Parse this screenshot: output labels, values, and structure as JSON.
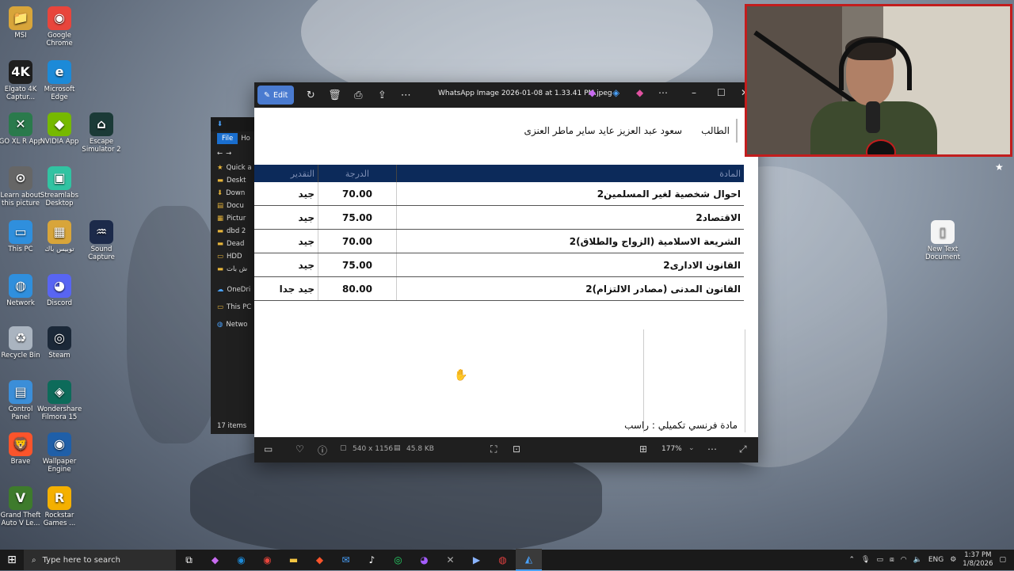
{
  "desktop_icons": [
    {
      "label": "MSI",
      "color": "#d8a53a",
      "glyph": "📁"
    },
    {
      "label": "Google Chrome",
      "color": "#e8453c",
      "glyph": "◉"
    },
    {
      "label": "Elgato 4K Captur...",
      "color": "#1f1f1f",
      "glyph": "4K"
    },
    {
      "label": "Microsoft Edge",
      "color": "#1c8ad8",
      "glyph": "e"
    },
    {
      "label": "GO XL R App",
      "color": "#2a7a4c",
      "glyph": "✕"
    },
    {
      "label": "NVIDIA App",
      "color": "#76b900",
      "glyph": "◆"
    },
    {
      "label": "Escape Simulator 2",
      "color": "#1b3a37",
      "glyph": "⌂"
    },
    {
      "label": "Learn about this picture",
      "color": "#666666",
      "glyph": "⊙"
    },
    {
      "label": "Streamlabs Desktop",
      "color": "#31c3a2",
      "glyph": "▣"
    },
    {
      "label": "This PC",
      "color": "#2f8fdd",
      "glyph": "▭"
    },
    {
      "label": "توبيس باك",
      "color": "#d8a53a",
      "glyph": "▦"
    },
    {
      "label": "Sound Capture",
      "color": "#1c2a4a",
      "glyph": "♒"
    },
    {
      "label": "Network",
      "color": "#2f8fdd",
      "glyph": "◍"
    },
    {
      "label": "Discord",
      "color": "#5865f2",
      "glyph": "◕"
    },
    {
      "label": "Recycle Bin",
      "color": "#aab4c0",
      "glyph": "♻"
    },
    {
      "label": "Steam",
      "color": "#1b2838",
      "glyph": "◎"
    },
    {
      "label": "Control Panel",
      "color": "#3b8ed8",
      "glyph": "▤"
    },
    {
      "label": "Wondershare Filmora 15",
      "color": "#0d6b5a",
      "glyph": "◈"
    },
    {
      "label": "Brave",
      "color": "#fb542b",
      "glyph": "🦁"
    },
    {
      "label": "Wallpaper Engine",
      "color": "#1f5fa8",
      "glyph": "◉"
    },
    {
      "label": "Grand Theft Auto V Le...",
      "color": "#3e7b2c",
      "glyph": "V"
    },
    {
      "label": "Rockstar Games ...",
      "color": "#f4b000",
      "glyph": "R"
    },
    {
      "label": "New Text Document",
      "color": "#f4f4f4",
      "glyph": "▯"
    }
  ],
  "explorer": {
    "menu_file": "File",
    "menu_home": "Ho",
    "items": [
      "Quick a",
      "Deskt",
      "Down",
      "Docu",
      "Pictur",
      "dbd 2",
      "Dead",
      "HDD",
      "ش بات",
      "OneDri",
      "This PC",
      "Netwo"
    ],
    "status": "17 items"
  },
  "viewer": {
    "edit_label": "Edit",
    "title": "WhatsApp Image 2026-01-08 at 1.33.41 PM.jpeg",
    "student_label": "الطالب",
    "student_name": "سعود عبد العزيز عايد ساير ماطر العنزى",
    "table_headers": {
      "subject": "المادة",
      "grade": "الدرجة",
      "rating": "التقدير"
    },
    "rows": [
      {
        "subject": "احوال شخصية لغير المسلمين2",
        "grade": "70.00",
        "rating": "جيد"
      },
      {
        "subject": "الاقتصاد2",
        "grade": "75.00",
        "rating": "جيد"
      },
      {
        "subject": "الشريعة الاسلامية (الزواج والطلاق)2",
        "grade": "70.00",
        "rating": "جيد"
      },
      {
        "subject": "القانون الادارى2",
        "grade": "75.00",
        "rating": "جيد"
      },
      {
        "subject": "القانون المدنى (مصادر الالتزام)2",
        "grade": "80.00",
        "rating": "جيد جدا"
      }
    ],
    "french_note": "مادة فرنسي تكميلي : راسب",
    "dimensions": "540 x 1156",
    "file_size": "45.8 KB",
    "zoom": "177%"
  },
  "taskbar": {
    "search_placeholder": "Type here to search",
    "language": "ENG",
    "time": "1:37 PM",
    "date": "1/8/2026"
  }
}
